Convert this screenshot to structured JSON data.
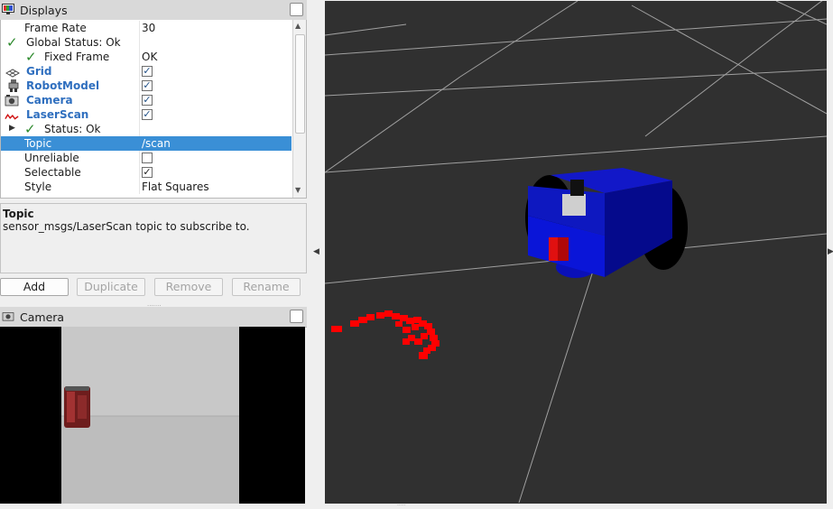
{
  "displays": {
    "title": "Displays",
    "tree": [
      {
        "name": "Frame Rate",
        "value": "30",
        "kind": "prop"
      },
      {
        "name": "Global Status: Ok",
        "value": "",
        "kind": "status"
      },
      {
        "name": "Fixed Frame",
        "value": "OK",
        "kind": "status-child"
      },
      {
        "name": "Grid",
        "value": "",
        "kind": "display",
        "checked": true
      },
      {
        "name": "RobotModel",
        "value": "",
        "kind": "display",
        "checked": true
      },
      {
        "name": "Camera",
        "value": "",
        "kind": "display",
        "checked": true
      },
      {
        "name": "LaserScan",
        "value": "",
        "kind": "display",
        "checked": true
      },
      {
        "name": "Status: Ok",
        "value": "",
        "kind": "status-collapsed"
      },
      {
        "name": "Topic",
        "value": "/scan",
        "kind": "prop",
        "selected": true
      },
      {
        "name": "Unreliable",
        "value": "",
        "kind": "prop",
        "checked": false
      },
      {
        "name": "Selectable",
        "value": "",
        "kind": "prop",
        "checked": true
      },
      {
        "name": "Style",
        "value": "Flat Squares",
        "kind": "prop"
      }
    ],
    "description": {
      "title": "Topic",
      "text": "sensor_msgs/LaserScan topic to subscribe to."
    },
    "buttons": {
      "add": "Add",
      "duplicate": "Duplicate",
      "remove": "Remove",
      "rename": "Rename"
    }
  },
  "camera": {
    "title": "Camera"
  },
  "colors": {
    "selection": "#3a8fd6",
    "display_name": "#2f6fbf",
    "robot_body": "#0a0fb8",
    "laser_points": "#ff0000",
    "view_background": "#303030"
  },
  "icons": {
    "displays": "monitor-icon",
    "grid": "grid-icon",
    "robot_model": "robot-icon",
    "camera": "camera-icon",
    "laser_scan": "laser-scan-icon",
    "status_ok": "check-icon"
  }
}
